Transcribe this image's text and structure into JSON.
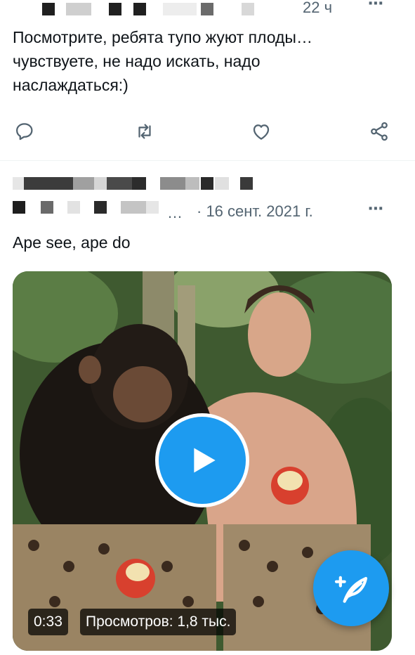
{
  "tweet1": {
    "time": "22 ч",
    "more_icon": "⋯",
    "text": "Посмотрите, ребята тупо жуют плоды…\nчувствуете, не надо искать, надо\nнаслаждаться:)"
  },
  "tweet2": {
    "ellipsis": "…",
    "date": "· 16 сент. 2021 г.",
    "more_icon": "⋯",
    "text": "Ape see, ape do",
    "video": {
      "duration": "0:33",
      "views": "Просмотров: 1,8 тыс."
    }
  },
  "icons": {
    "reply": "reply-icon",
    "retweet": "retweet-icon",
    "like": "heart-icon",
    "share": "share-icon",
    "play": "play-icon",
    "compose": "compose-tweet-icon"
  },
  "colors": {
    "accent": "#1d9bf0",
    "secondary_text": "#536471",
    "text": "#0f1419"
  }
}
